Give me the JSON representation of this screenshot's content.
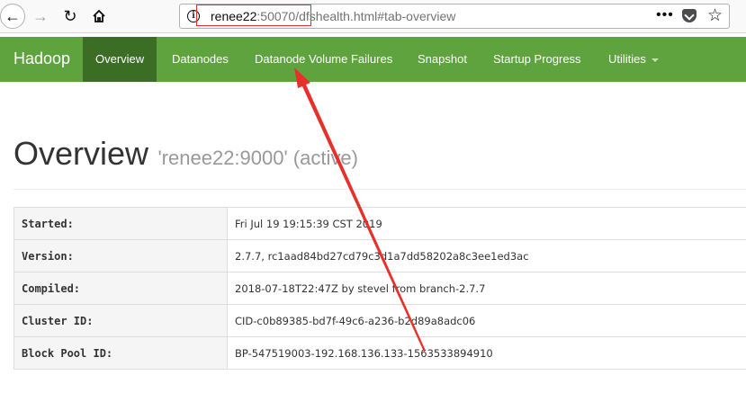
{
  "browser": {
    "url_host": "renee22",
    "url_port": ":50070/",
    "url_path": "dfshealth.html#tab-overview",
    "more_glyph": "•••"
  },
  "navbar": {
    "brand": "Hadoop",
    "items": [
      {
        "label": "Overview",
        "active": true
      },
      {
        "label": "Datanodes"
      },
      {
        "label": "Datanode Volume Failures"
      },
      {
        "label": "Snapshot"
      },
      {
        "label": "Startup Progress"
      },
      {
        "label": "Utilities"
      }
    ]
  },
  "page": {
    "title": "Overview",
    "subtitle": "'renee22:9000' (active)"
  },
  "overview_table": [
    {
      "key": "Started:",
      "value": "Fri Jul 19 19:15:39 CST 2019"
    },
    {
      "key": "Version:",
      "value": "2.7.7, rc1aad84bd27cd79c3d1a7dd58202a8c3ee1ed3ac"
    },
    {
      "key": "Compiled:",
      "value": "2018-07-18T22:47Z by stevel from branch-2.7.7"
    },
    {
      "key": "Cluster ID:",
      "value": "CID-c0b89385-bd7f-49c6-a236-b2d89a8adc06"
    },
    {
      "key": "Block Pool ID:",
      "value": "BP-547519003-192.168.136.133-1563533894910"
    }
  ],
  "colors": {
    "navbar": "#5fa33e",
    "navbar_active": "#3b6e24",
    "annotation": "#e8302a"
  }
}
